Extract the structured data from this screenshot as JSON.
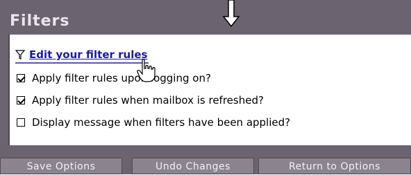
{
  "section": {
    "title": "Filters"
  },
  "edit_link": {
    "label": "Edit your filter rules",
    "icon": "funnel-icon"
  },
  "options": [
    {
      "label": "Apply filter rules upon logging on?",
      "checked": true
    },
    {
      "label": "Apply filter rules when mailbox is refreshed?",
      "checked": true
    },
    {
      "label": "Display message when filters have been applied?",
      "checked": false
    }
  ],
  "buttons": {
    "save": "Save Options",
    "undo": "Undo Changes",
    "return": "Return to Options"
  },
  "colors": {
    "header_bg": "#6b6470",
    "link": "#1b1aa6",
    "button_bg": "#8b838e"
  }
}
